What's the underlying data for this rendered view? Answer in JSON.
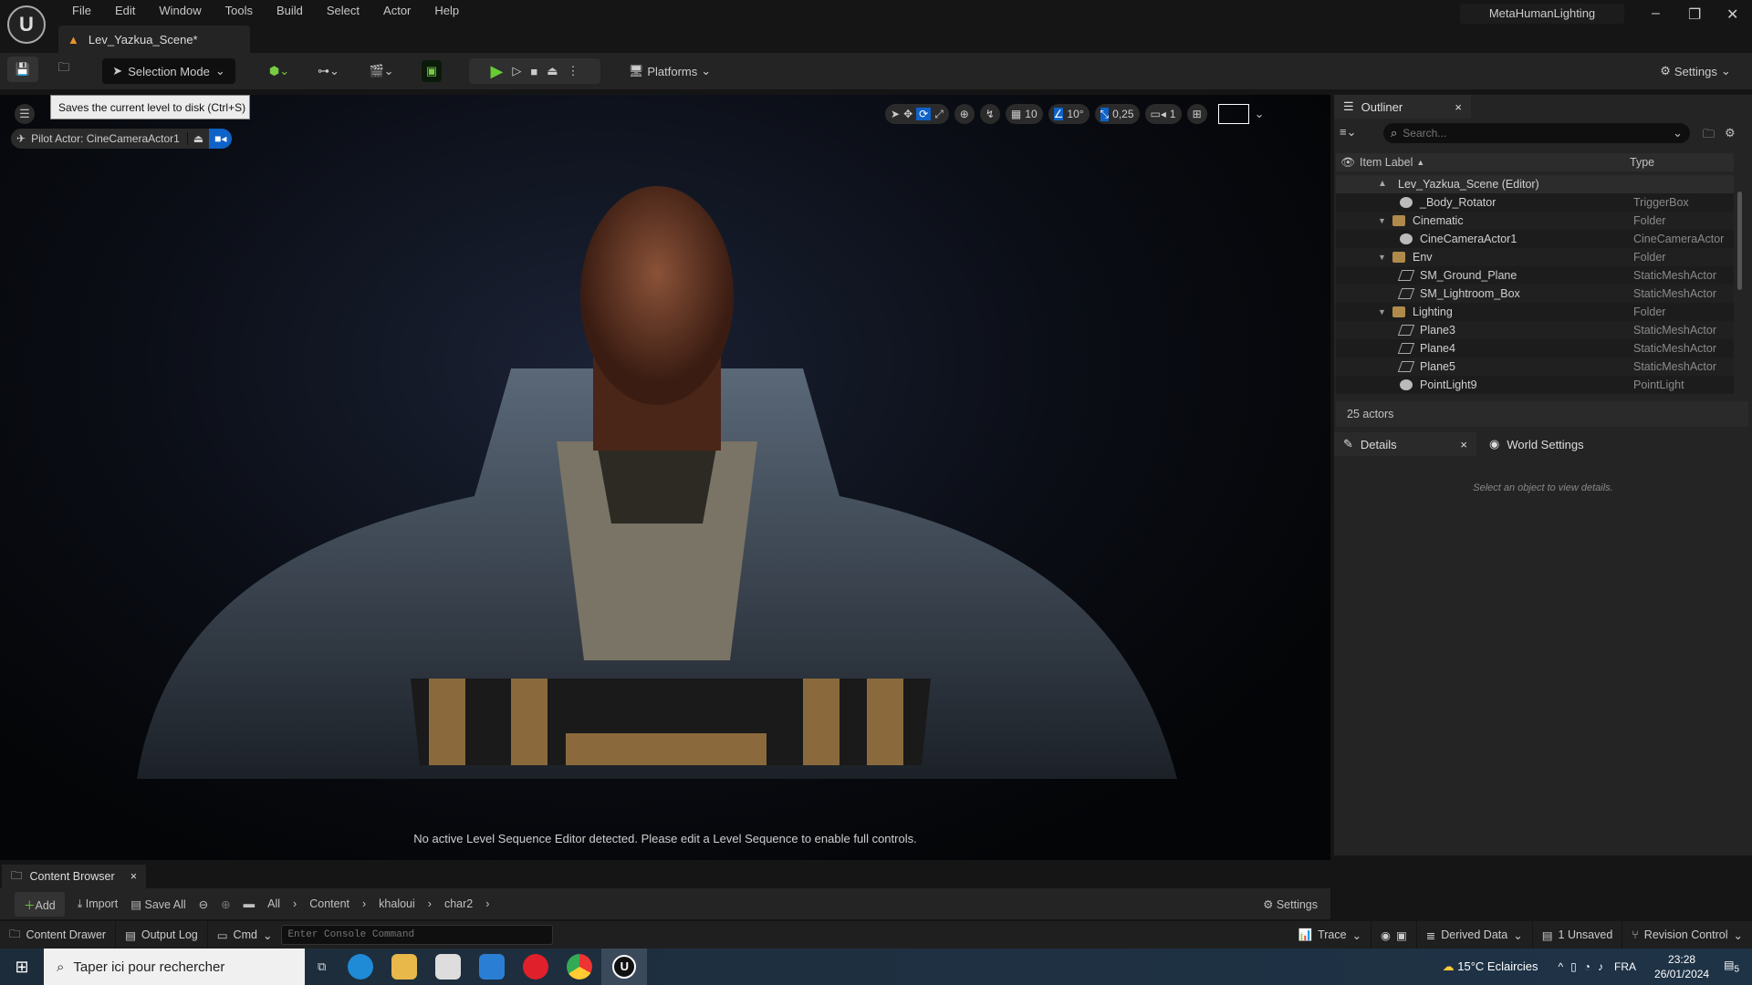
{
  "menu": [
    "File",
    "Edit",
    "Window",
    "Tools",
    "Build",
    "Select",
    "Actor",
    "Help"
  ],
  "level_tab": "Lev_Yazkua_Scene*",
  "project": "MetaHumanLighting",
  "toolbar": {
    "selection_mode": "Selection Mode",
    "platforms": "Platforms",
    "settings": "Settings"
  },
  "tooltip": "Saves the current level to disk (Ctrl+S)",
  "viewport": {
    "pilot": "Pilot Actor: CineCameraActor1",
    "grid": "10",
    "angle": "10°",
    "scale": "0,25",
    "camera_speed": "1",
    "message": "No active Level Sequence Editor detected. Please edit a Level Sequence to enable full controls."
  },
  "outliner": {
    "title": "Outliner",
    "search_placeholder": "Search...",
    "col_label": "Item Label",
    "col_type": "Type",
    "root": "Lev_Yazkua_Scene (Editor)",
    "items": [
      {
        "label": "_Body_Rotator",
        "type": "TriggerBox"
      },
      {
        "label": "Cinematic",
        "type": "Folder"
      },
      {
        "label": "CineCameraActor1",
        "type": "CineCameraActor"
      },
      {
        "label": "Env",
        "type": "Folder"
      },
      {
        "label": "SM_Ground_Plane",
        "type": "StaticMeshActor"
      },
      {
        "label": "SM_Lightroom_Box",
        "type": "StaticMeshActor"
      },
      {
        "label": "Lighting",
        "type": "Folder"
      },
      {
        "label": "Plane3",
        "type": "StaticMeshActor"
      },
      {
        "label": "Plane4",
        "type": "StaticMeshActor"
      },
      {
        "label": "Plane5",
        "type": "StaticMeshActor"
      },
      {
        "label": "PointLight9",
        "type": "PointLight"
      }
    ],
    "count": "25 actors"
  },
  "details": {
    "tab": "Details",
    "world_tab": "World Settings",
    "empty": "Select an object to view details."
  },
  "content_browser": {
    "tab": "Content Browser",
    "add": "Add",
    "import": "Import",
    "save_all": "Save All",
    "path": [
      "All",
      "Content",
      "khaloui",
      "char2"
    ],
    "settings": "Settings"
  },
  "statusbar": {
    "drawer": "Content Drawer",
    "output": "Output Log",
    "cmd": "Cmd",
    "console_placeholder": "Enter Console Command",
    "trace": "Trace",
    "derived": "Derived Data",
    "unsaved": "1 Unsaved",
    "revision": "Revision Control"
  },
  "taskbar": {
    "search": "Taper ici pour rechercher",
    "weather": "15°C  Eclaircies",
    "lang": "FRA",
    "time": "23:28",
    "date": "26/01/2024",
    "notif": "5"
  }
}
